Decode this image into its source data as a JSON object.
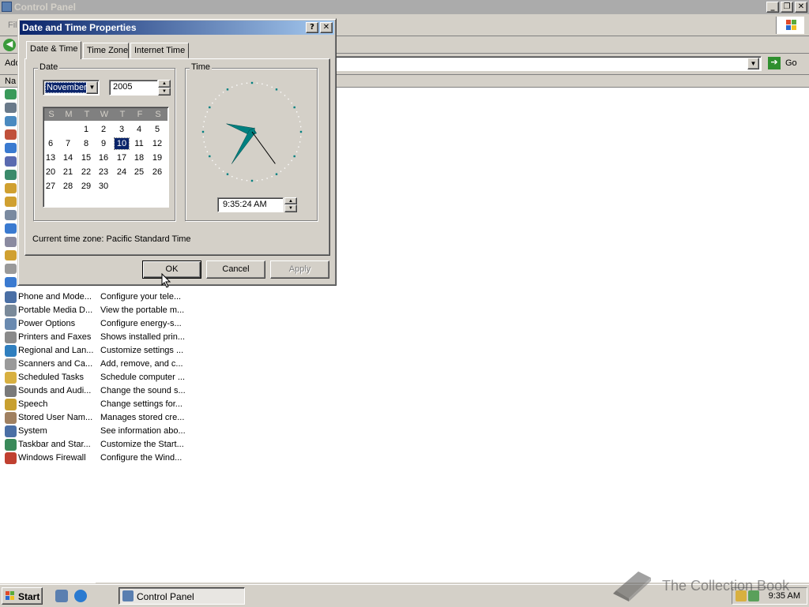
{
  "main_window": {
    "title": "Control Panel",
    "menu_file": "File",
    "address_label": "Add",
    "go_label": "Go",
    "column_name": "Na",
    "items": [
      {
        "name": "Phone and Mode...",
        "desc": "Configure your tele...",
        "color": "#4a6fa5"
      },
      {
        "name": "Portable Media D...",
        "desc": "View the portable m...",
        "color": "#7a8a9a"
      },
      {
        "name": "Power Options",
        "desc": "Configure energy-s...",
        "color": "#6a8ab0"
      },
      {
        "name": "Printers and Faxes",
        "desc": "Shows installed prin...",
        "color": "#8a8a8a"
      },
      {
        "name": "Regional and Lan...",
        "desc": "Customize settings ...",
        "color": "#2f7fbf"
      },
      {
        "name": "Scanners and Ca...",
        "desc": "Add, remove, and c...",
        "color": "#9a9a9a"
      },
      {
        "name": "Scheduled Tasks",
        "desc": "Schedule computer ...",
        "color": "#d8b040"
      },
      {
        "name": "Sounds and Audi...",
        "desc": "Change the sound s...",
        "color": "#7a7a7a"
      },
      {
        "name": "Speech",
        "desc": "Change settings for...",
        "color": "#c8a030"
      },
      {
        "name": "Stored User Nam...",
        "desc": "Manages stored cre...",
        "color": "#a08060"
      },
      {
        "name": "System",
        "desc": "See information abo...",
        "color": "#4a6fa5"
      },
      {
        "name": "Taskbar and Star...",
        "desc": "Customize the Start...",
        "color": "#3a8a5a"
      },
      {
        "name": "Windows Firewall",
        "desc": "Configure the Wind...",
        "color": "#c04030"
      }
    ]
  },
  "dialog": {
    "title": "Date and Time Properties",
    "help_btn": "?",
    "close_btn": "✕",
    "tabs": [
      "Date & Time",
      "Time Zone",
      "Internet Time"
    ],
    "date_group": "Date",
    "time_group": "Time",
    "month": "November",
    "year": "2005",
    "weekdays": [
      "S",
      "M",
      "T",
      "W",
      "T",
      "F",
      "S"
    ],
    "first_weekday_index": 2,
    "days_in_month": 30,
    "selected_day": 10,
    "time_value": "9:35:24 AM",
    "clock": {
      "hour": 9,
      "minute": 35,
      "second": 24,
      "face_color": "#008080"
    },
    "timezone_label": "Current time zone:",
    "timezone_value": "Pacific Standard Time",
    "ok": "OK",
    "cancel": "Cancel",
    "apply": "Apply"
  },
  "taskbar": {
    "start": "Start",
    "task": "Control Panel",
    "clock": "9:35 AM"
  },
  "watermark": "The Collection Book"
}
